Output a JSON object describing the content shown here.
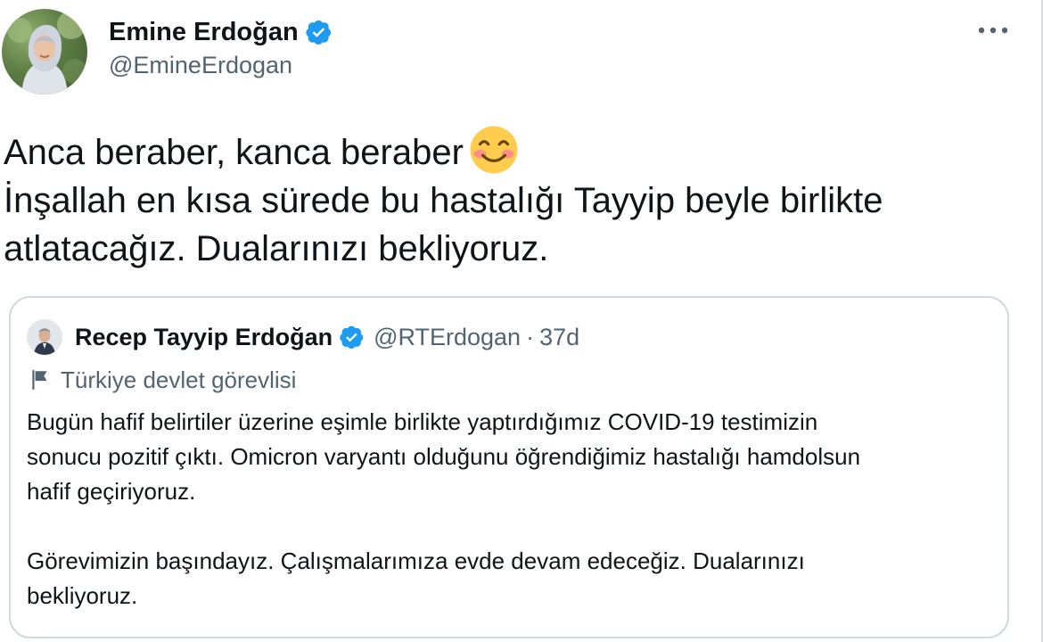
{
  "tweet": {
    "author": {
      "display_name": "Emine Erdoğan",
      "handle": "@EmineErdogan",
      "verified": true
    },
    "text_lines": [
      "Anca beraber, kanca beraber",
      "İnşallah en kısa sürede bu hastalığı Tayyip beyle birlikte",
      "atlatacağız. Dualarınızı bekliyoruz."
    ],
    "emoji": "smiling-face-with-smiling-eyes"
  },
  "quote": {
    "author": {
      "display_name": "Recep Tayyip Erdoğan",
      "handle": "@RTErdogan",
      "verified": true
    },
    "separator": "·",
    "time": "37d",
    "label": "Türkiye devlet görevlisi",
    "body_lines": [
      "Bugün hafif belirtiler üzerine eşimle birlikte yaptırdığımız COVID-19 testimizin",
      "sonucu pozitif çıktı. Omicron varyantı olduğunu öğrendiğimiz hastalığı hamdolsun",
      "hafif geçiriyoruz."
    ],
    "body_lines_2": [
      "Görevimizin başındayız. Çalışmalarımıza evde devam edeceğiz. Dualarınızı",
      "bekliyoruz."
    ]
  },
  "colors": {
    "verified_blue": "#1d9bf0",
    "secondary_text": "#536471",
    "border": "#cfd9de"
  },
  "icons": {
    "more": "more-horizontal-icon",
    "verified": "verified-badge-icon",
    "government": "flag-icon"
  }
}
